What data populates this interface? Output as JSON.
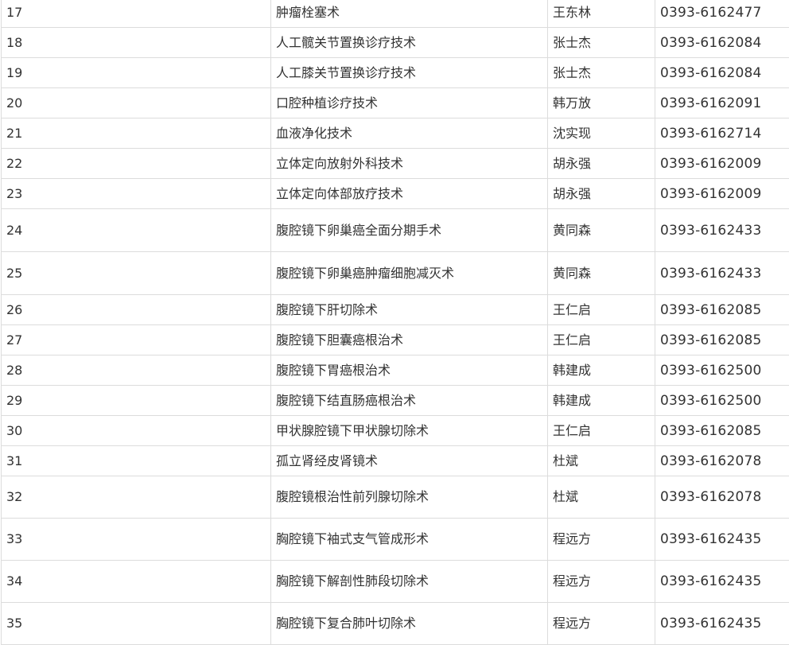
{
  "table": {
    "rows": [
      {
        "no": "17",
        "name": "肿瘤栓塞术",
        "doctor": "王东林",
        "phone": "0393-6162477"
      },
      {
        "no": "18",
        "name": "人工髋关节置换诊疗技术",
        "doctor": "张士杰",
        "phone": "0393-6162084"
      },
      {
        "no": "19",
        "name": "人工膝关节置换诊疗技术",
        "doctor": "张士杰",
        "phone": "0393-6162084"
      },
      {
        "no": "20",
        "name": "口腔种植诊疗技术",
        "doctor": "韩万放",
        "phone": "0393-6162091"
      },
      {
        "no": "21",
        "name": "血液净化技术",
        "doctor": "沈实现",
        "phone": "0393-6162714"
      },
      {
        "no": "22",
        "name": "立体定向放射外科技术",
        "doctor": "胡永强",
        "phone": "0393-6162009"
      },
      {
        "no": "23",
        "name": "立体定向体部放疗技术",
        "doctor": "胡永强",
        "phone": "0393-6162009"
      },
      {
        "no": "24",
        "name": "腹腔镜下卵巢癌全面分期手术",
        "doctor": "黄同森",
        "phone": "0393-6162433"
      },
      {
        "no": "25",
        "name": "腹腔镜下卵巢癌肿瘤细胞减灭术",
        "doctor": "黄同森",
        "phone": "0393-6162433"
      },
      {
        "no": "26",
        "name": "腹腔镜下肝切除术",
        "doctor": "王仁启",
        "phone": "0393-6162085"
      },
      {
        "no": "27",
        "name": "腹腔镜下胆囊癌根治术",
        "doctor": "王仁启",
        "phone": "0393-6162085"
      },
      {
        "no": "28",
        "name": "腹腔镜下胃癌根治术",
        "doctor": "韩建成",
        "phone": "0393-6162500"
      },
      {
        "no": "29",
        "name": "腹腔镜下结直肠癌根治术",
        "doctor": "韩建成",
        "phone": "0393-6162500"
      },
      {
        "no": "30",
        "name": "甲状腺腔镜下甲状腺切除术",
        "doctor": "王仁启",
        "phone": "0393-6162085"
      },
      {
        "no": "31",
        "name": "孤立肾经皮肾镜术",
        "doctor": "杜斌",
        "phone": "0393-6162078"
      },
      {
        "no": "32",
        "name": "腹腔镜根治性前列腺切除术",
        "doctor": "杜斌",
        "phone": "0393-6162078"
      },
      {
        "no": "33",
        "name": "胸腔镜下袖式支气管成形术",
        "doctor": "程远方",
        "phone": "0393-6162435"
      },
      {
        "no": "34",
        "name": "胸腔镜下解剖性肺段切除术",
        "doctor": "程远方",
        "phone": "0393-6162435"
      },
      {
        "no": "35",
        "name": "胸腔镜下复合肺叶切除术",
        "doctor": "程远方",
        "phone": "0393-6162435"
      }
    ]
  }
}
